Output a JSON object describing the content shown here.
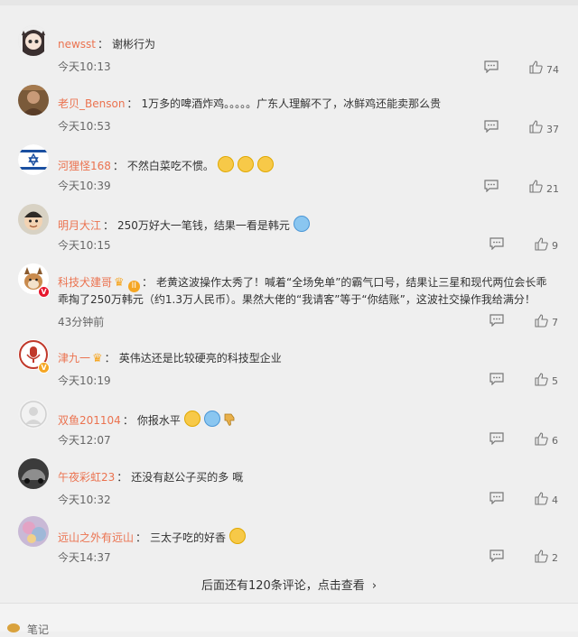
{
  "comments": [
    {
      "username": "newsst",
      "text": "谢彬行为",
      "time": "今天10:13",
      "likes": "74",
      "avatar_icon": "anime-girl-avatar"
    },
    {
      "username": "老贝_Benson",
      "text": "1万多的啤酒炸鸡。。。。。广东人理解不了，冰鲜鸡还能卖那么贵",
      "time": "今天10:53",
      "likes": "37",
      "avatar_icon": "man-photo-avatar"
    },
    {
      "username": "河狸怪168",
      "text": "不然白菜吃不惯。",
      "time": "今天10:39",
      "likes": "21",
      "avatar_icon": "israel-flag-avatar"
    },
    {
      "username": "明月大江",
      "text": "250万好大一笔钱，结果一看是韩元",
      "time": "今天10:15",
      "likes": "9",
      "avatar_icon": "cartoon-boy-avatar"
    },
    {
      "username": "科技犬建哥",
      "rank": "II",
      "text_line1": "老黄这波操作太秀了！喊着“全场免单”的霸气口号，结果让三星和现代两位会长乖",
      "text_line2": "乖掏了250万韩元（约1.3万人民币）。果然大佬的“我请客”等于“你结账”，这波社交操作我给满分！",
      "time": "43分钟前",
      "likes": "7",
      "avatar_icon": "dog-avatar"
    },
    {
      "username": "津九一",
      "text": "英伟达还是比较硬亮的科技型企业",
      "time": "今天10:19",
      "likes": "5",
      "avatar_icon": "microphone-avatar"
    },
    {
      "username": "双鱼201104",
      "text": "你报水平",
      "time": "今天12:07",
      "likes": "6",
      "avatar_icon": "default-user-avatar"
    },
    {
      "username": "午夜彩虹23",
      "text": "还没有赵公子买的多 嘅",
      "time": "今天10:32",
      "likes": "4",
      "avatar_icon": "car-avatar"
    },
    {
      "username": "远山之外有远山",
      "text": "三太子吃的好香",
      "time": "今天14:37",
      "likes": "2",
      "avatar_icon": "colorful-avatar"
    }
  ],
  "more_comments_label": "后面还有120条评论，点击查看",
  "footer_label": "笔记",
  "colors": {
    "username": "#eb7350",
    "background": "#efefef"
  }
}
